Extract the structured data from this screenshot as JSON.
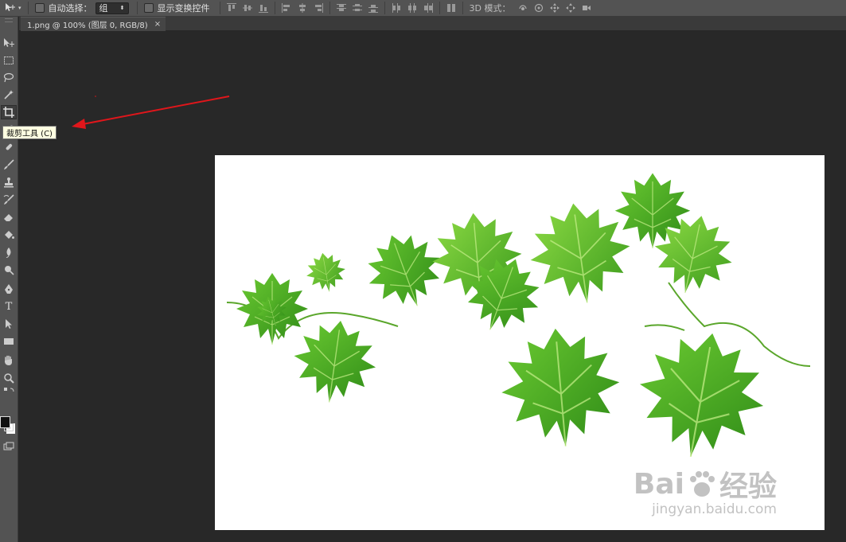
{
  "options_bar": {
    "auto_select_label": "自动选择：",
    "auto_select_value": "组",
    "show_transform_label": "显示变换控件",
    "mode_3d_label": "3D 模式："
  },
  "document_tab": {
    "title": "1.png @ 100% (图层 0, RGB/8)",
    "close_glyph": "×"
  },
  "tooltip": {
    "text": "裁剪工具 (C)"
  },
  "toolbar": {
    "tools": [
      "move-tool-icon",
      "marquee-tool-icon",
      "lasso-tool-icon",
      "magic-wand-tool-icon",
      "crop-tool-icon",
      "eyedropper-tool-icon",
      "healing-brush-tool-icon",
      "brush-tool-icon",
      "clone-stamp-tool-icon",
      "history-brush-tool-icon",
      "eraser-tool-icon",
      "paint-bucket-tool-icon",
      "blur-tool-icon",
      "dodge-tool-icon",
      "pen-tool-icon",
      "type-tool-icon",
      "path-selection-tool-icon",
      "rectangle-tool-icon",
      "hand-tool-icon",
      "zoom-tool-icon"
    ],
    "active_tool": "crop-tool-icon",
    "type_tool_glyph": "T"
  },
  "canvas": {
    "image_description_icon": "grape-leaves-image",
    "watermark_main": "Bai",
    "watermark_main_tail": "经验",
    "watermark_sub": "jingyan.baidu.com"
  },
  "colors": {
    "arrow": "#e0161b",
    "foreground": "#111111",
    "background": "#ffffff",
    "leaf_dark": "#3f9b1e",
    "leaf_light": "#7fd13a"
  }
}
